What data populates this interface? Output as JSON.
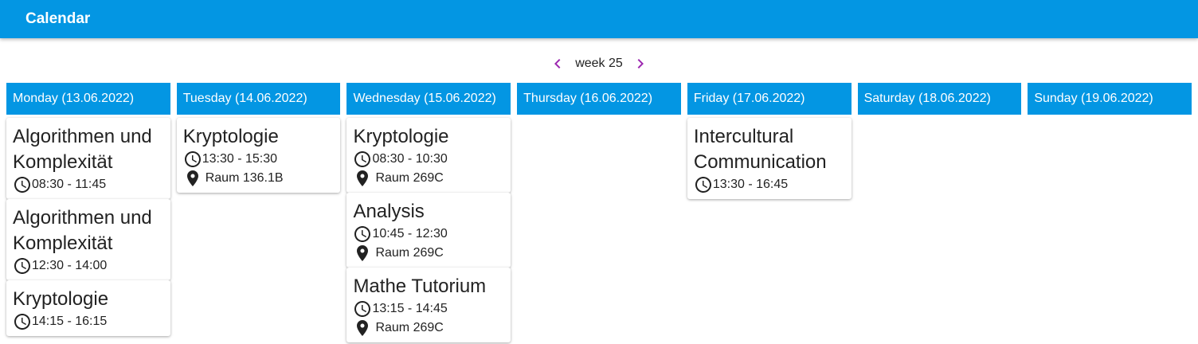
{
  "app": {
    "title": "Calendar"
  },
  "week_nav": {
    "label": "week 25",
    "prev_icon": "chevron-left-icon",
    "next_icon": "chevron-right-icon"
  },
  "colors": {
    "primary": "#0396e3",
    "nav_accent": "#9c27b0"
  },
  "days": [
    {
      "header": "Monday (13.06.2022)",
      "events": [
        {
          "title": "Algorithmen und Komplexität",
          "time": "08:30 - 11:45",
          "location": ""
        },
        {
          "title": "Algorithmen und Komplexität",
          "time": "12:30 - 14:00",
          "location": ""
        },
        {
          "title": "Kryptologie",
          "time": "14:15 - 16:15",
          "location": ""
        }
      ]
    },
    {
      "header": "Tuesday (14.06.2022)",
      "events": [
        {
          "title": "Kryptologie",
          "time": "13:30 - 15:30",
          "location": "Raum 136.1B"
        }
      ]
    },
    {
      "header": "Wednesday (15.06.2022)",
      "events": [
        {
          "title": "Kryptologie",
          "time": "08:30 - 10:30",
          "location": "Raum 269C"
        },
        {
          "title": "Analysis",
          "time": "10:45 - 12:30",
          "location": "Raum 269C"
        },
        {
          "title": "Mathe Tutorium",
          "time": "13:15 - 14:45",
          "location": "Raum 269C"
        }
      ]
    },
    {
      "header": "Thursday (16.06.2022)",
      "events": []
    },
    {
      "header": "Friday (17.06.2022)",
      "events": [
        {
          "title": "Intercultural Communication",
          "time": "13:30 - 16:45",
          "location": ""
        }
      ]
    },
    {
      "header": "Saturday (18.06.2022)",
      "events": []
    },
    {
      "header": "Sunday (19.06.2022)",
      "events": []
    }
  ]
}
